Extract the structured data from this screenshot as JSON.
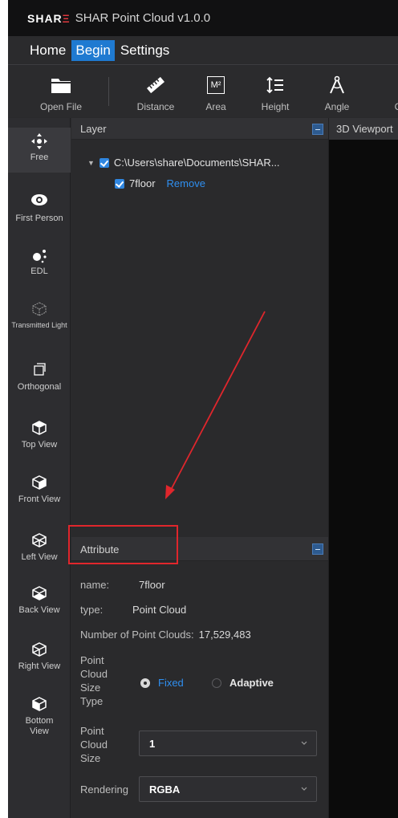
{
  "titlebar": {
    "logo_main": "SHAR",
    "logo_accent": "Ξ",
    "title": "SHAR Point Cloud v1.0.0"
  },
  "menu": [
    "Home",
    "Begin",
    "Settings"
  ],
  "toolbar": {
    "items": [
      {
        "label": "Open File",
        "icon": "folder-icon"
      },
      {
        "label": "Distance",
        "icon": "ruler-icon"
      },
      {
        "label": "Area",
        "icon": "area-m2-icon",
        "icon_text": "M²"
      },
      {
        "label": "Height",
        "icon": "height-icon"
      },
      {
        "label": "Angle",
        "icon": "angle-icon"
      },
      {
        "label": "C",
        "icon": ""
      }
    ]
  },
  "views": [
    {
      "label": "Free",
      "icon": "move-icon"
    },
    {
      "label": "First Person",
      "icon": "eye-icon"
    },
    {
      "label": "EDL",
      "icon": "dots-icon"
    },
    {
      "label": "Transmitted Light",
      "icon": "cube-outline-icon"
    },
    {
      "label": "Orthogonal",
      "icon": "orthogonal-icon"
    },
    {
      "label": "Top View",
      "icon": "cube-top-icon"
    },
    {
      "label": "Front View",
      "icon": "cube-front-icon"
    },
    {
      "label": "Left View",
      "icon": "cube-left-icon"
    },
    {
      "label": "Back View",
      "icon": "cube-back-icon"
    },
    {
      "label": "Right View",
      "icon": "cube-right-icon"
    },
    {
      "label": "Bottom View",
      "icon": "cube-bottom-icon"
    }
  ],
  "layer_panel": {
    "title": "Layer",
    "root_path": "C:\\Users\\share\\Documents\\SHAR...",
    "child_name": "7floor",
    "remove_label": "Remove"
  },
  "attribute_panel": {
    "title": "Attribute",
    "name_key": "name:",
    "name_value": "7floor",
    "type_key": "type:",
    "type_value": "Point Cloud",
    "count_key": "Number of Point Clouds:",
    "count_value": "17,529,483",
    "size_type_label": "Point Cloud Size Type",
    "size_type_options": [
      "Fixed",
      "Adaptive"
    ],
    "size_type_selected": "Fixed",
    "size_label": "Point Cloud Size",
    "size_value": "1",
    "rendering_label": "Rendering",
    "rendering_value": "RGBA"
  },
  "viewport": {
    "tab": "3D Viewport"
  },
  "colors": {
    "accent": "#1f7ad1",
    "link": "#2f8ff0",
    "annotation": "#e0262c"
  }
}
